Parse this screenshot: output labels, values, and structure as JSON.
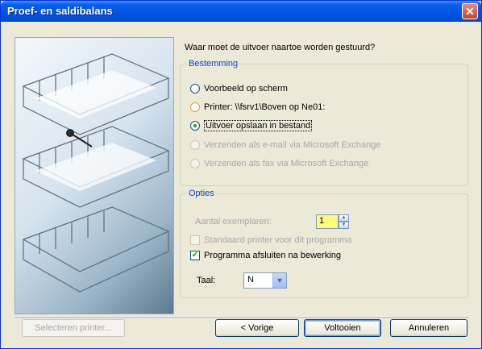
{
  "window": {
    "title": "Proef- en saldibalans",
    "close_glyph": "✕"
  },
  "question": "Waar moet de uitvoer naartoe worden gestuurd?",
  "destination": {
    "legend": "Bestemming",
    "options": [
      {
        "label": "Voorbeeld op scherm",
        "checked": false,
        "disabled": false
      },
      {
        "label": "Printer: \\\\fsrv1\\Boven op Ne01:",
        "checked": false,
        "disabled": false
      },
      {
        "label": "Uitvoer opslaan in bestand",
        "checked": true,
        "disabled": false
      },
      {
        "label": "Verzenden als e-mail via Microsoft Exchange",
        "checked": false,
        "disabled": true
      },
      {
        "label": "Verzenden als fax via Microsoft Exchange",
        "checked": false,
        "disabled": true
      }
    ]
  },
  "options": {
    "legend": "Opties",
    "copies_label": "Aantal exemplaren:",
    "copies_value": "1",
    "default_printer_label": "Standaard printer voor dit programma",
    "close_program_label": "Programma afsluiten na bewerking",
    "close_program_checked": true,
    "language_label": "Taal:",
    "language_value": "N",
    "check_glyph": "✔",
    "up_glyph": "▲",
    "down_glyph": "▼",
    "dropdown_glyph": "▼"
  },
  "buttons": {
    "select_printer": "Selecteren printer...",
    "back": "< Vorige",
    "finish": "Voltooien",
    "cancel": "Annuleren"
  },
  "colors": {
    "accent": "#0054e3",
    "legend": "#0046d5",
    "spinner_bg": "#fffa78"
  }
}
